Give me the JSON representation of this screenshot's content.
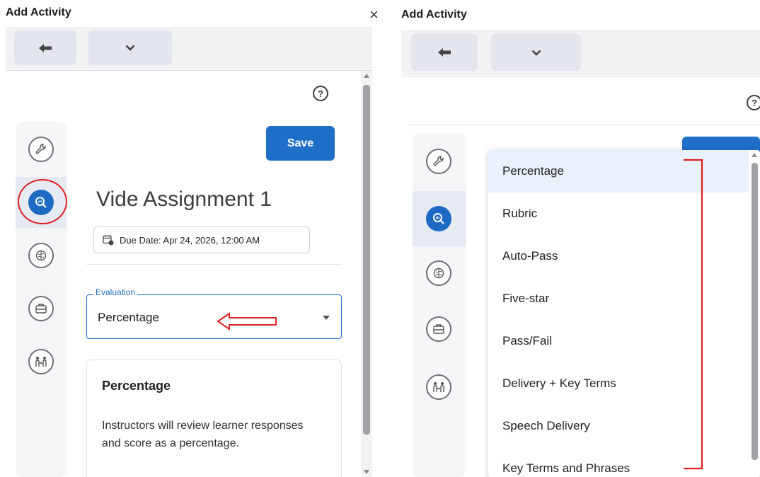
{
  "left_panel": {
    "title": "Add Activity",
    "close_label": "×",
    "save_label": "Save",
    "assignment_title": "Vide Assignment 1",
    "due_date": "Due Date: Apr 24, 2026, 12:00 AM",
    "evaluation": {
      "legend": "Evaluation",
      "value": "Percentage"
    },
    "card": {
      "title": "Percentage",
      "description": "Instructors will review learner responses and score as a percentage."
    },
    "rail_icons": [
      "wrench-icon",
      "evaluation-magnifier-icon",
      "brain-icon",
      "toolbox-icon",
      "people-exchange-icon"
    ],
    "accent": "#1f6fc9",
    "highlight_annotation_color": "#e02020"
  },
  "right_panel": {
    "title": "Add Activity",
    "evaluation_options": [
      "Percentage",
      "Rubric",
      "Auto-Pass",
      "Five-star",
      "Pass/Fail",
      "Delivery + Key Terms",
      "Speech Delivery",
      "Key Terms and Phrases"
    ],
    "selected_option": "Percentage"
  }
}
